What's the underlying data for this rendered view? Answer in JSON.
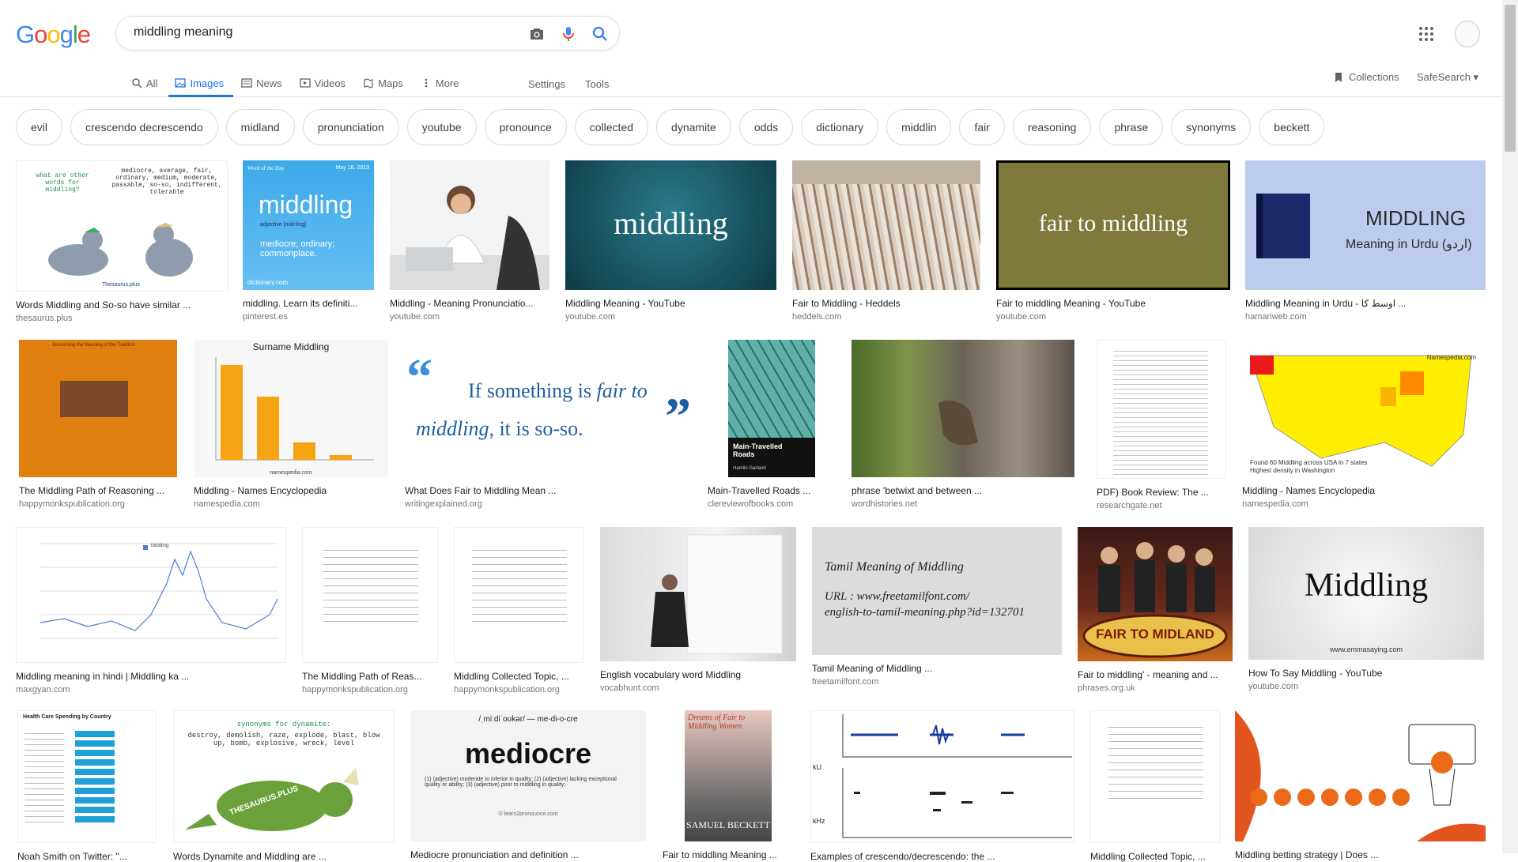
{
  "logo": "Google",
  "search": {
    "value": "middling meaning"
  },
  "tabs": [
    "All",
    "Images",
    "News",
    "Videos",
    "Maps",
    "More"
  ],
  "settings": "Settings",
  "tools": "Tools",
  "collections": "Collections",
  "safesearch": "SafeSearch",
  "chips": [
    "evil",
    "crescendo decrescendo",
    "midland",
    "pronunciation",
    "youtube",
    "pronounce",
    "collected",
    "dynamite",
    "odds",
    "dictionary",
    "middlin",
    "fair",
    "reasoning",
    "phrase",
    "synonyms",
    "beckett"
  ],
  "results": [
    {
      "caption": "Words Middling and So-so have similar ...",
      "source": "thesaurus.plus",
      "thumb": {
        "word_title": "what are other words for middling?",
        "words": "mediocre, average, fair, ordinary, medium, moderate, passable, so-so, indifferent, tolerable",
        "site": "Thesaurus.plus"
      }
    },
    {
      "caption": "middling. Learn its definiti...",
      "source": "pinterest.es",
      "thumb": {
        "label": "Word of the Day",
        "date": "May 18, 2013",
        "word": "middling",
        "pos": "adjective [mid-ling]",
        "def": "mediocre; ordinary; commonplace.",
        "site": "dictionary.com"
      }
    },
    {
      "caption": "Middling - Meaning Pronunciatio...",
      "source": "youtube.com"
    },
    {
      "caption": "Middling Meaning - YouTube",
      "source": "youtube.com",
      "thumb": {
        "word": "middling"
      }
    },
    {
      "caption": "Fair to Middling - Heddels",
      "source": "heddels.com"
    },
    {
      "caption": "Fair to middling Meaning - YouTube",
      "source": "youtube.com",
      "thumb": {
        "text": "fair to middling"
      }
    },
    {
      "caption": "Middling Meaning in Urdu - اوسط کا ...",
      "source": "hamariweb.com",
      "thumb": {
        "title": "MIDDLING",
        "sub": "Meaning in Urdu (اردو)"
      }
    },
    {
      "caption": "The Middling Path of Reasoning ...",
      "source": "happymonkspublication.org",
      "thumb": {
        "title": "Discerning the Meaning of the Tradition"
      }
    },
    {
      "caption": "Middling - Names Encyclopedia",
      "source": "namespedia.com",
      "thumb": {
        "title": "Surname Middling",
        "site": "namespedia.com"
      }
    },
    {
      "caption": "What Does Fair to Middling Mean ...",
      "source": "writingexplained.org",
      "thumb": {
        "line1": "If something is ",
        "line1_em": "fair to",
        "line2_em": "middling,",
        "line2": " it is so-so."
      }
    },
    {
      "caption": "Main-Travelled Roads ...",
      "source": "clereviewofbooks.com",
      "thumb": {
        "title": "Main-Travelled Roads",
        "author": "Hamlin Garland"
      }
    },
    {
      "caption": "phrase 'betwixt and between ...",
      "source": "wordhistories.net"
    },
    {
      "caption": "PDF) Book Review: The ...",
      "source": "researchgate.net"
    },
    {
      "caption": "Middling - Names Encyclopedia",
      "source": "namespedia.com",
      "thumb": {
        "site": "Namespedia.com",
        "note": "Found 60 Middling across USA in 7 states",
        "note2": "Highest density in Washington"
      }
    },
    {
      "caption": "Middling meaning in hindi | Middling ka ...",
      "source": "maxgyan.com",
      "thumb": {
        "legend": "Middling"
      }
    },
    {
      "caption": "The Middling Path of Reas...",
      "source": "happymonkspublication.org"
    },
    {
      "caption": "Middling Collected Topic, ...",
      "source": "happymonkspublication.org"
    },
    {
      "caption": "English vocabulary word Middling",
      "source": "vocabhunt.com"
    },
    {
      "caption": "Tamil Meaning of Middling ...",
      "source": "freetamilfont.com",
      "thumb": {
        "title": "Tamil Meaning of Middling",
        "url": "URL : www.freetamilfont.com/",
        "url2": "english-to-tamil-meaning.php?id=132701"
      }
    },
    {
      "caption": "Fair to middling' - meaning and ...",
      "source": "phrases.org.uk",
      "thumb": {
        "text": "FAIR TO MIDLAND"
      }
    },
    {
      "caption": "How To Say Middling - YouTube",
      "source": "youtube.com",
      "thumb": {
        "word": "Middling",
        "site": "www.emmasaying.com"
      }
    },
    {
      "caption": "Noah Smith on Twitter: \"...",
      "source": "",
      "thumb": {
        "title": "Health Care Spending by Country"
      }
    },
    {
      "caption": "Words Dynamite and Middling are ...",
      "source": "",
      "thumb": {
        "title": "synonyms for dynamite:",
        "words": "destroy, demolish, raze, explode, blast, blow up, bomb, explosive, wreck, level",
        "site": "THESAURUS.PLUS"
      }
    },
    {
      "caption": "Mediocre pronunciation and definition ...",
      "source": "",
      "thumb": {
        "phon": "/ˌmiːdiˈoʊkər/ — me-di-o-cre",
        "word": "mediocre",
        "def": "(1) (adjective) moderate to inferior in quality; (2) (adjective) lacking exceptional quality or ability; (3) (adjective) poor to middling in quality;",
        "site": "© learn2pronounce.com"
      }
    },
    {
      "caption": "Fair to middling Meaning ...",
      "source": "",
      "thumb": {
        "title": "Dreams of Fair to Middling Women",
        "author": "SAMUEL BECKETT"
      }
    },
    {
      "caption": "Examples of crescendo/decrescendo: the ...",
      "source": "",
      "thumb": {
        "ylabel_top": "kU",
        "ylabel_bot": "kHz"
      }
    },
    {
      "caption": "Middling Collected Topic, ...",
      "source": ""
    },
    {
      "caption": "Middling betting strategy | Does ...",
      "source": ""
    }
  ],
  "colors": {
    "link": "#1a73e8",
    "logo_blue": "#4285f4",
    "logo_red": "#ea4335",
    "logo_yellow": "#fbbc05",
    "logo_green": "#34a853"
  }
}
